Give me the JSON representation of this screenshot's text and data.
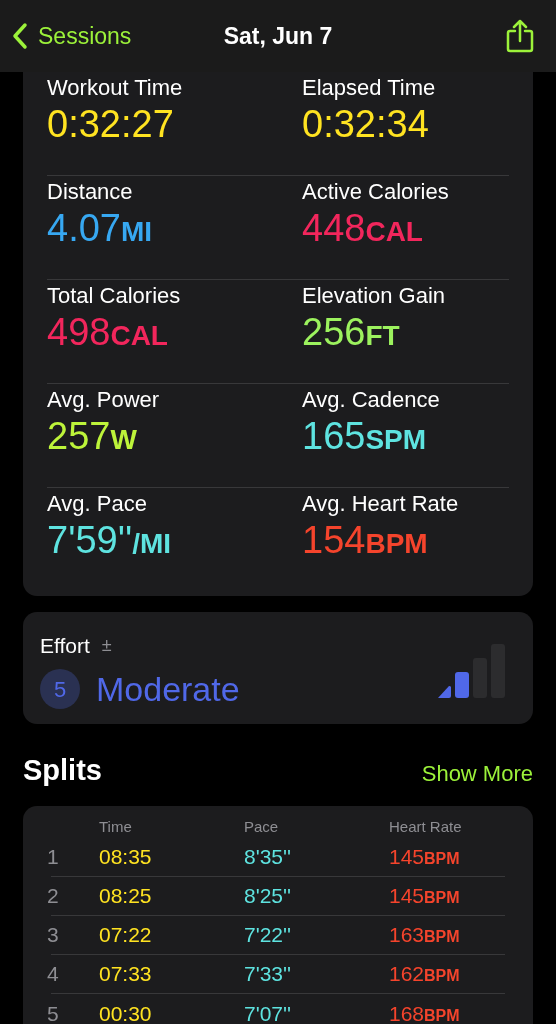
{
  "nav": {
    "back_label": "Sessions",
    "title": "Sat, Jun 7"
  },
  "metrics": [
    {
      "label": "Workout Time",
      "value": "0:32:27",
      "color": "#ffe321"
    },
    {
      "label": "Elapsed Time",
      "value": "0:32:34",
      "color": "#ffe321"
    },
    {
      "label": "Distance",
      "value": "4.07",
      "unit": "MI",
      "color": "#37a8f2"
    },
    {
      "label": "Active Calories",
      "value": "448",
      "unit": "CAL",
      "color": "#f2265c"
    },
    {
      "label": "Total Calories",
      "value": "498",
      "unit": "CAL",
      "color": "#f2265c"
    },
    {
      "label": "Elevation Gain",
      "value": "256",
      "unit": "FT",
      "color": "#9cf25e"
    },
    {
      "label": "Avg. Power",
      "value": "257",
      "unit": "W",
      "color": "#bdf43a"
    },
    {
      "label": "Avg. Cadence",
      "value": "165",
      "unit": "SPM",
      "color": "#5ee3e0"
    },
    {
      "label": "Avg. Pace",
      "value": "7'59''",
      "unit": "/MI",
      "color": "#5ee3e0"
    },
    {
      "label": "Avg. Heart Rate",
      "value": "154",
      "unit": "BPM",
      "color": "#f5442c"
    }
  ],
  "effort": {
    "label": "Effort",
    "adjust_symbol": "±",
    "score": "5",
    "rating": "Moderate"
  },
  "splits": {
    "title": "Splits",
    "show_more": "Show More",
    "columns": [
      "Time",
      "Pace",
      "Heart Rate"
    ],
    "rows": [
      {
        "index": "1",
        "time": "08:35",
        "pace": "8'35''",
        "heart_rate": "145",
        "unit": "BPM"
      },
      {
        "index": "2",
        "time": "08:25",
        "pace": "8'25''",
        "heart_rate": "145",
        "unit": "BPM"
      },
      {
        "index": "3",
        "time": "07:22",
        "pace": "7'22''",
        "heart_rate": "163",
        "unit": "BPM"
      },
      {
        "index": "4",
        "time": "07:33",
        "pace": "7'33''",
        "heart_rate": "162",
        "unit": "BPM"
      },
      {
        "index": "5",
        "time": "00:30",
        "pace": "7'07''",
        "heart_rate": "168",
        "unit": "BPM"
      }
    ]
  }
}
